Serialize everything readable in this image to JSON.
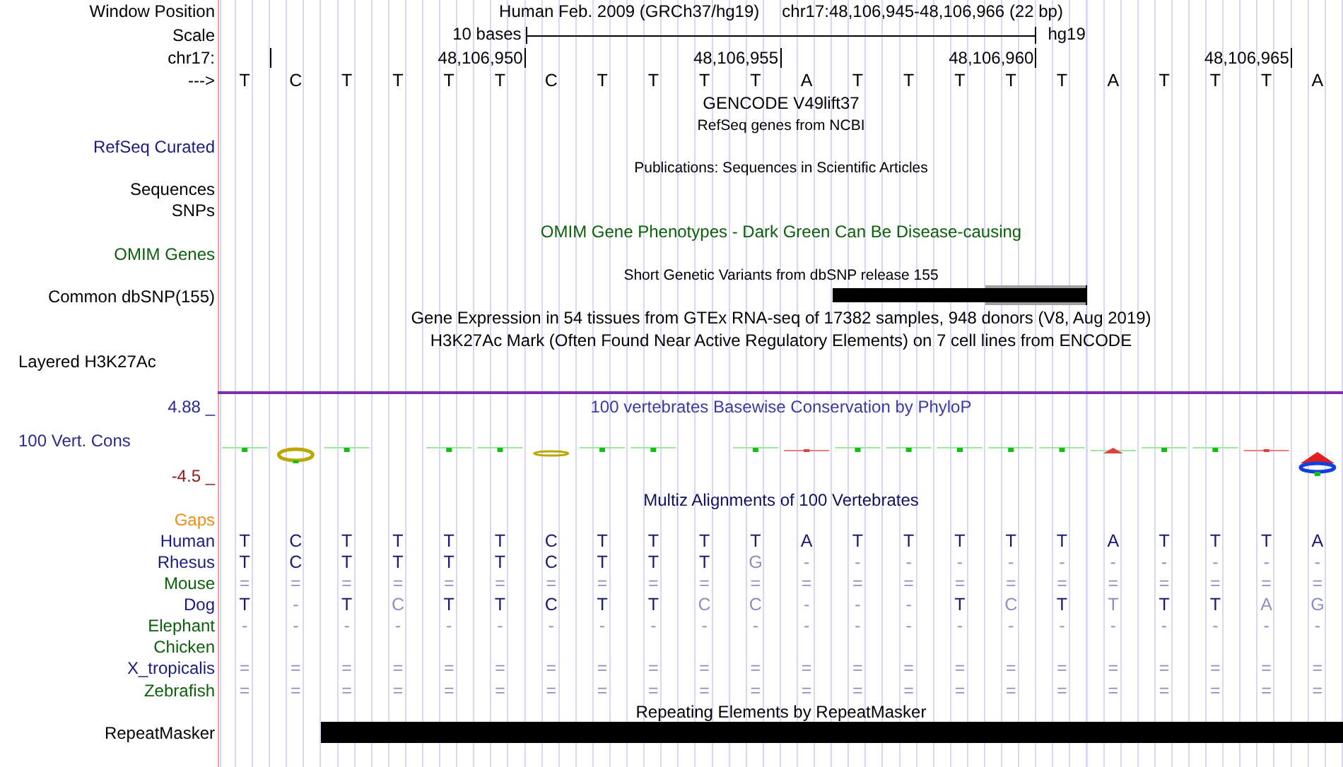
{
  "window_position": {
    "label": "Window Position",
    "title": "Human Feb. 2009 (GRCh37/hg19)",
    "range": "chr17:48,106,945-48,106,966 (22 bp)"
  },
  "scale": {
    "label": "Scale",
    "length": "10 bases",
    "assembly": "hg19"
  },
  "coordinates": {
    "label": "chr17:",
    "ticks": [
      "48,106,950",
      "48,106,955",
      "48,106,960",
      "48,106,965"
    ]
  },
  "sequence": {
    "label": "--->",
    "bases": [
      "T",
      "C",
      "T",
      "T",
      "T",
      "T",
      "C",
      "T",
      "T",
      "T",
      "T",
      "A",
      "T",
      "T",
      "T",
      "T",
      "T",
      "A",
      "T",
      "T",
      "T",
      "A"
    ]
  },
  "tracks": [
    {
      "kind": "title",
      "text": "GENCODE V49lift37"
    },
    {
      "kind": "subtitle",
      "text": "RefSeq genes from NCBI"
    },
    {
      "kind": "label",
      "label": "RefSeq Curated",
      "color": "#1a1a80"
    },
    {
      "kind": "subtitle",
      "text": "Publications: Sequences in Scientific Articles"
    },
    {
      "kind": "label",
      "label": "Sequences",
      "color": "#000000"
    },
    {
      "kind": "label",
      "label": "SNPs",
      "color": "#000000"
    },
    {
      "kind": "title",
      "text": "OMIM Gene Phenotypes - Dark Green Can Be Disease-causing",
      "color": "#0c600c"
    },
    {
      "kind": "label",
      "label": "OMIM Genes",
      "color": "#0c600c"
    },
    {
      "kind": "subtitle",
      "text": "Short Genetic Variants from dbSNP release 155"
    },
    {
      "kind": "variants",
      "label": "Common dbSNP(155)",
      "color": "#000000"
    },
    {
      "kind": "title",
      "text": "Gene Expression in 54 tissues from GTEx RNA-seq of 17382 samples, 948 donors (V8, Aug 2019)"
    },
    {
      "kind": "title",
      "text": "H3K27Ac Mark (Often Found Near Active Regulatory Elements) on 7 cell lines from ENCODE"
    },
    {
      "kind": "layered",
      "label": "Layered H3K27Ac",
      "color": "#000000"
    }
  ],
  "conservation": {
    "title": "100 vertebrates Basewise Conservation by PhyloP",
    "label": "100 Vert. Cons",
    "max": "4.88 _",
    "min": "-4.5 _"
  },
  "alignment": {
    "title": "Multiz Alignments of 100 Vertebrates",
    "gaps_label": "Gaps",
    "species": [
      {
        "name": "Human",
        "color": "#1a1a80",
        "cells": [
          {
            "base": "T",
            "faded": false
          },
          {
            "base": "C",
            "faded": false
          },
          {
            "base": "T",
            "faded": false
          },
          {
            "base": "T",
            "faded": false
          },
          {
            "base": "T",
            "faded": false
          },
          {
            "base": "T",
            "faded": false
          },
          {
            "base": "C",
            "faded": false
          },
          {
            "base": "T",
            "faded": false
          },
          {
            "base": "T",
            "faded": false
          },
          {
            "base": "T",
            "faded": false
          },
          {
            "base": "T",
            "faded": false
          },
          {
            "base": "A",
            "faded": false
          },
          {
            "base": "T",
            "faded": false
          },
          {
            "base": "T",
            "faded": false
          },
          {
            "base": "T",
            "faded": false
          },
          {
            "base": "T",
            "faded": false
          },
          {
            "base": "T",
            "faded": false
          },
          {
            "base": "A",
            "faded": false
          },
          {
            "base": "T",
            "faded": false
          },
          {
            "base": "T",
            "faded": false
          },
          {
            "base": "T",
            "faded": false
          },
          {
            "base": "A",
            "faded": false
          }
        ]
      },
      {
        "name": "Rhesus",
        "color": "#1a1a80",
        "cells": [
          {
            "base": "T",
            "faded": false
          },
          {
            "base": "C",
            "faded": false
          },
          {
            "base": "T",
            "faded": false
          },
          {
            "base": "T",
            "faded": false
          },
          {
            "base": "T",
            "faded": false
          },
          {
            "base": "T",
            "faded": false
          },
          {
            "base": "C",
            "faded": false
          },
          {
            "base": "T",
            "faded": false
          },
          {
            "base": "T",
            "faded": false
          },
          {
            "base": "T",
            "faded": false
          },
          {
            "base": "G",
            "faded": true
          },
          {
            "base": "-",
            "faded": true
          },
          {
            "base": "-",
            "faded": true
          },
          {
            "base": "-",
            "faded": true
          },
          {
            "base": "-",
            "faded": true
          },
          {
            "base": "-",
            "faded": true
          },
          {
            "base": "-",
            "faded": true
          },
          {
            "base": "-",
            "faded": true
          },
          {
            "base": "-",
            "faded": true
          },
          {
            "base": "-",
            "faded": true
          },
          {
            "base": "-",
            "faded": true
          },
          {
            "base": "-",
            "faded": true
          }
        ]
      },
      {
        "name": "Mouse",
        "color": "#0c600c",
        "cells": [
          {
            "base": "=",
            "faded": true
          },
          {
            "base": "=",
            "faded": true
          },
          {
            "base": "=",
            "faded": true
          },
          {
            "base": "=",
            "faded": true
          },
          {
            "base": "=",
            "faded": true
          },
          {
            "base": "=",
            "faded": true
          },
          {
            "base": "=",
            "faded": true
          },
          {
            "base": "=",
            "faded": true
          },
          {
            "base": "=",
            "faded": true
          },
          {
            "base": "=",
            "faded": true
          },
          {
            "base": "=",
            "faded": true
          },
          {
            "base": "=",
            "faded": true
          },
          {
            "base": "=",
            "faded": true
          },
          {
            "base": "=",
            "faded": true
          },
          {
            "base": "=",
            "faded": true
          },
          {
            "base": "=",
            "faded": true
          },
          {
            "base": "=",
            "faded": true
          },
          {
            "base": "=",
            "faded": true
          },
          {
            "base": "=",
            "faded": true
          },
          {
            "base": "=",
            "faded": true
          },
          {
            "base": "=",
            "faded": true
          },
          {
            "base": "=",
            "faded": true
          }
        ]
      },
      {
        "name": "Dog",
        "color": "#1a1a80",
        "cells": [
          {
            "base": "T",
            "faded": false
          },
          {
            "base": "-",
            "faded": true
          },
          {
            "base": "T",
            "faded": false
          },
          {
            "base": "C",
            "faded": true
          },
          {
            "base": "T",
            "faded": false
          },
          {
            "base": "T",
            "faded": false
          },
          {
            "base": "C",
            "faded": false
          },
          {
            "base": "T",
            "faded": false
          },
          {
            "base": "T",
            "faded": false
          },
          {
            "base": "C",
            "faded": true
          },
          {
            "base": "C",
            "faded": true
          },
          {
            "base": "-",
            "faded": true
          },
          {
            "base": "-",
            "faded": true
          },
          {
            "base": "-",
            "faded": true
          },
          {
            "base": "T",
            "faded": false
          },
          {
            "base": "C",
            "faded": true
          },
          {
            "base": "T",
            "faded": false
          },
          {
            "base": "T",
            "faded": true
          },
          {
            "base": "T",
            "faded": false
          },
          {
            "base": "T",
            "faded": false
          },
          {
            "base": "A",
            "faded": true
          },
          {
            "base": "G",
            "faded": true
          }
        ]
      },
      {
        "name": "Elephant",
        "color": "#0c600c",
        "cells": [
          {
            "base": "-",
            "faded": true
          },
          {
            "base": "-",
            "faded": true
          },
          {
            "base": "-",
            "faded": true
          },
          {
            "base": "-",
            "faded": true
          },
          {
            "base": "-",
            "faded": true
          },
          {
            "base": "-",
            "faded": true
          },
          {
            "base": "-",
            "faded": true
          },
          {
            "base": "-",
            "faded": true
          },
          {
            "base": "-",
            "faded": true
          },
          {
            "base": "-",
            "faded": true
          },
          {
            "base": "-",
            "faded": true
          },
          {
            "base": "-",
            "faded": true
          },
          {
            "base": "-",
            "faded": true
          },
          {
            "base": "-",
            "faded": true
          },
          {
            "base": "-",
            "faded": true
          },
          {
            "base": "-",
            "faded": true
          },
          {
            "base": "-",
            "faded": true
          },
          {
            "base": "-",
            "faded": true
          },
          {
            "base": "-",
            "faded": true
          },
          {
            "base": "-",
            "faded": true
          },
          {
            "base": "-",
            "faded": true
          },
          {
            "base": "-",
            "faded": true
          }
        ]
      },
      {
        "name": "Chicken",
        "color": "#0c600c"
      },
      {
        "name": "X_tropicalis",
        "color": "#1a1a80",
        "cells": [
          {
            "base": "=",
            "faded": true
          },
          {
            "base": "=",
            "faded": true
          },
          {
            "base": "=",
            "faded": true
          },
          {
            "base": "=",
            "faded": true
          },
          {
            "base": "=",
            "faded": true
          },
          {
            "base": "=",
            "faded": true
          },
          {
            "base": "=",
            "faded": true
          },
          {
            "base": "=",
            "faded": true
          },
          {
            "base": "=",
            "faded": true
          },
          {
            "base": "=",
            "faded": true
          },
          {
            "base": "=",
            "faded": true
          },
          {
            "base": "=",
            "faded": true
          },
          {
            "base": "=",
            "faded": true
          },
          {
            "base": "=",
            "faded": true
          },
          {
            "base": "=",
            "faded": true
          },
          {
            "base": "=",
            "faded": true
          },
          {
            "base": "=",
            "faded": true
          },
          {
            "base": "=",
            "faded": true
          },
          {
            "base": "=",
            "faded": true
          },
          {
            "base": "=",
            "faded": true
          },
          {
            "base": "=",
            "faded": true
          },
          {
            "base": "=",
            "faded": true
          }
        ]
      },
      {
        "name": "Zebrafish",
        "color": "#0c600c",
        "cells": [
          {
            "base": "=",
            "faded": true
          },
          {
            "base": "=",
            "faded": true
          },
          {
            "base": "=",
            "faded": true
          },
          {
            "base": "=",
            "faded": true
          },
          {
            "base": "=",
            "faded": true
          },
          {
            "base": "=",
            "faded": true
          },
          {
            "base": "=",
            "faded": true
          },
          {
            "base": "=",
            "faded": true
          },
          {
            "base": "=",
            "faded": true
          },
          {
            "base": "=",
            "faded": true
          },
          {
            "base": "=",
            "faded": true
          },
          {
            "base": "=",
            "faded": true
          },
          {
            "base": "=",
            "faded": true
          },
          {
            "base": "=",
            "faded": true
          },
          {
            "base": "=",
            "faded": true
          },
          {
            "base": "=",
            "faded": true
          },
          {
            "base": "=",
            "faded": true
          },
          {
            "base": "=",
            "faded": true
          },
          {
            "base": "=",
            "faded": true
          },
          {
            "base": "=",
            "faded": true
          },
          {
            "base": "=",
            "faded": true
          },
          {
            "base": "=",
            "faded": true
          }
        ]
      }
    ]
  },
  "repeats": {
    "title": "Repeating Elements by RepeatMasker",
    "label": "RepeatMasker"
  }
}
